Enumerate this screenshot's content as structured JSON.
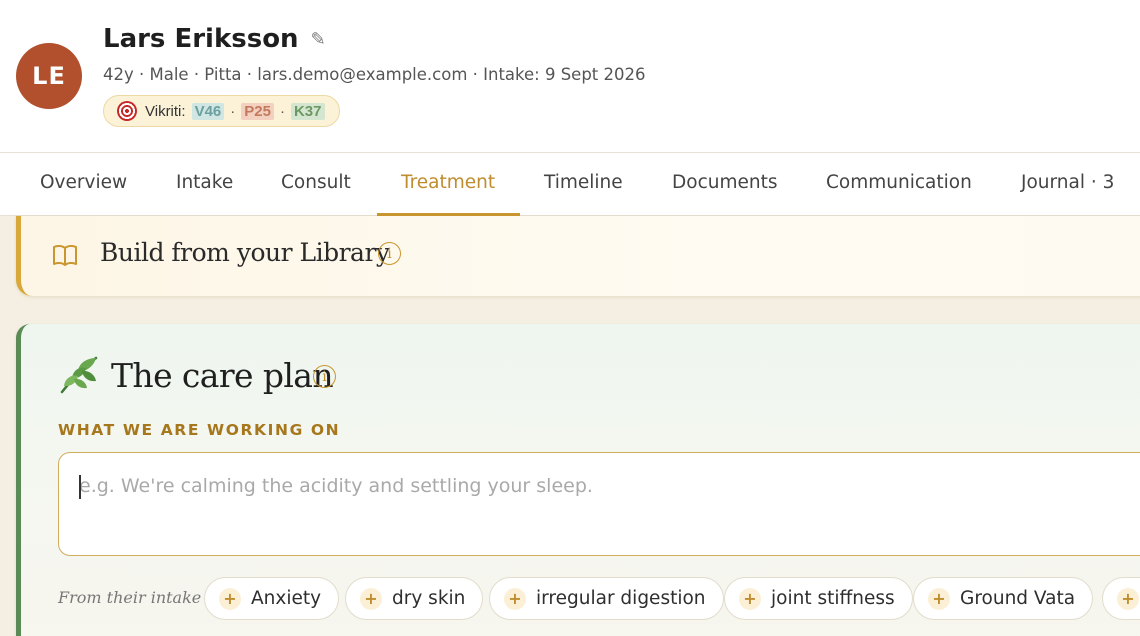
{
  "patient": {
    "initials": "LE",
    "name": "Lars Eriksson",
    "meta": "42y · Male · Pitta · lars.demo@example.com · Intake: 9 Sept 2026",
    "vikriti": {
      "label": "Vikriti:",
      "v": "V46",
      "p": "P25",
      "k": "K37",
      "sep": "·"
    }
  },
  "icons": {
    "edit": "pencil-icon",
    "vikriti": "target-icon",
    "library": "book-icon",
    "care_plan": "leaf-icon",
    "info": "info-icon",
    "chip": "plus-icon"
  },
  "tabs": [
    {
      "label": "Overview"
    },
    {
      "label": "Intake"
    },
    {
      "label": "Consult"
    },
    {
      "label": "Treatment",
      "active": true
    },
    {
      "label": "Timeline"
    },
    {
      "label": "Documents"
    },
    {
      "label": "Communication"
    },
    {
      "label": "Journal · 3"
    }
  ],
  "library": {
    "title": "Build from your Library",
    "info": "i"
  },
  "care_plan": {
    "title": "The care plan",
    "info": "i",
    "section_label": "WHAT WE ARE WORKING ON",
    "input_value": "",
    "input_placeholder": "e.g. We're calming the acidity and settling your sleep.",
    "intake_label": "From their intake",
    "chip_plus": "+",
    "chips": [
      "Anxiety",
      "dry skin",
      "irregular digestion",
      "joint stiffness",
      "Ground Vata",
      ""
    ]
  },
  "colors": {
    "accent_gold": "#c9962f",
    "avatar": "#b2502e",
    "care_green": "#5a8a56",
    "vata": "#6b9fa0",
    "pitta": "#c47a5c",
    "kapha": "#6d9863"
  }
}
